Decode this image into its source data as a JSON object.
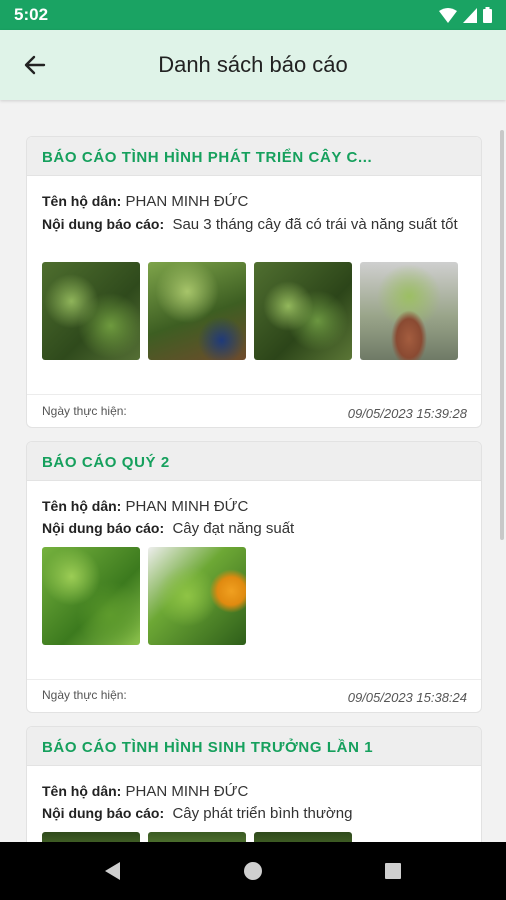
{
  "status_bar": {
    "time": "5:02"
  },
  "header": {
    "title": "Danh sách báo cáo"
  },
  "labels": {
    "household": "Tên hộ dân:",
    "content": "Nội dung báo cáo:",
    "date": "Ngày thực hiện:"
  },
  "reports": [
    {
      "title": "BÁO CÁO TÌNH HÌNH PHÁT TRIỂN CÂY C...",
      "household": "PHAN MINH ĐỨC",
      "content": "Sau 3 tháng cây đã có trái và năng suất tốt",
      "date": "09/05/2023 15:39:28"
    },
    {
      "title": "BÁO CÁO QUÝ 2",
      "household": "PHAN MINH ĐỨC",
      "content": "Cây đạt năng suất",
      "date": "09/05/2023 15:38:24"
    },
    {
      "title": "BÁO CÁO TÌNH HÌNH SINH TRƯỞNG LẦN 1",
      "household": "PHAN MINH ĐỨC",
      "content": "Cây phát triển bình thường",
      "date": ""
    }
  ],
  "icons": {
    "back": "arrow-left-icon",
    "wifi": "wifi-icon",
    "signal": "signal-icon",
    "battery": "battery-icon",
    "nav_back": "triangle-back-icon",
    "nav_home": "circle-home-icon",
    "nav_recent": "square-recent-icon"
  },
  "colors": {
    "status_bar": "#1aa363",
    "app_bar": "#dff3e8",
    "accent": "#16a05d"
  }
}
